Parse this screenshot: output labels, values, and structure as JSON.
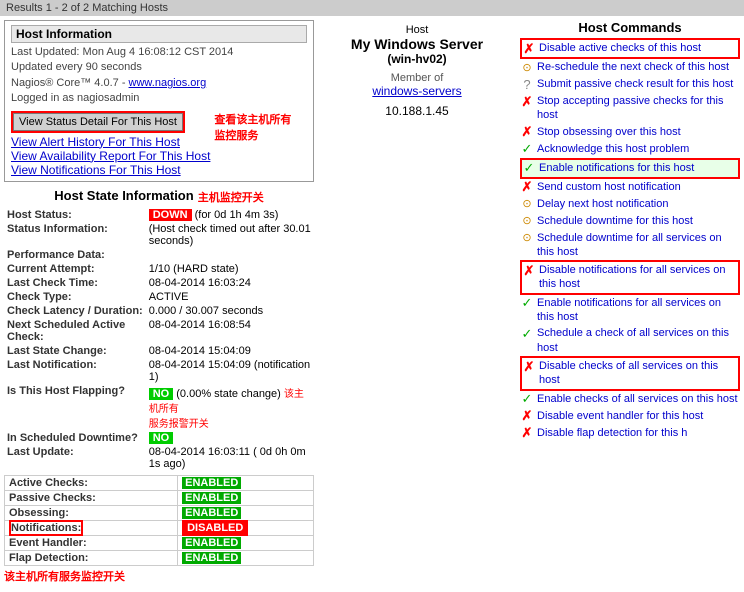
{
  "topbar": {
    "results_text": "Results 1 - 2 of 2 Matching Hosts"
  },
  "host_info": {
    "section_title": "Host Information",
    "last_updated": "Last Updated: Mon Aug 4 16:08:12 CST 2014",
    "update_interval": "Updated every 90 seconds",
    "nagios_version": "Nagios® Core™ 4.0.7 - ",
    "nagios_link_text": "www.nagios.org",
    "nagios_link": "http://www.nagios.org",
    "logged_in": "Logged in as nagiosadmin",
    "btn_view_status": "View Status Detail For This Host",
    "btn_view_alerts": "View Alert History For This Host",
    "btn_view_availability": "View Availability Report For This Host",
    "btn_view_notifications": "View Notifications For This Host",
    "annotation_1": "查看该主机所有\n监控服务"
  },
  "host_center": {
    "label": "Host",
    "name": "My Windows Server",
    "alias": "(win-hv02)",
    "member_of_label": "Member of",
    "member_group": "windows-servers",
    "ip_address": "10.188.1.45"
  },
  "host_state": {
    "section_title": "Host State Information",
    "annotation_title": "主机监控开关",
    "rows": [
      {
        "label": "Host Status:",
        "value": "",
        "badge": "DOWN",
        "badge_type": "down",
        "extra": "(for 0d 1h 4m 3s)"
      },
      {
        "label": "Status Information:",
        "value": "(Host check timed out after 30.01 seconds)",
        "badge": "",
        "badge_type": ""
      },
      {
        "label": "Performance Data:",
        "value": "",
        "badge": "",
        "badge_type": ""
      },
      {
        "label": "Current Attempt:",
        "value": "1/10  (HARD state)",
        "badge": "",
        "badge_type": ""
      },
      {
        "label": "Last Check Time:",
        "value": "08-04-2014 16:03:24",
        "badge": "",
        "badge_type": ""
      },
      {
        "label": "Check Type:",
        "value": "ACTIVE",
        "badge": "",
        "badge_type": ""
      },
      {
        "label": "Check Latency / Duration:",
        "value": "0.000 / 30.007 seconds",
        "badge": "",
        "badge_type": ""
      },
      {
        "label": "Next Scheduled Active Check:",
        "value": "08-04-2014 16:08:54",
        "badge": "",
        "badge_type": ""
      },
      {
        "label": "Last State Change:",
        "value": "08-04-2014 15:04:09",
        "badge": "",
        "badge_type": ""
      },
      {
        "label": "Last Notification:",
        "value": "08-04-2014 15:04:09 (notification 1)",
        "badge": "",
        "badge_type": ""
      },
      {
        "label": "Is This Host Flapping?",
        "value": "(0.00% state change)",
        "badge": "NO",
        "badge_type": "no"
      },
      {
        "label": "In Scheduled Downtime?",
        "value": "",
        "badge": "NO",
        "badge_type": "no"
      },
      {
        "label": "Last Update:",
        "value": "08-04-2014 16:03:11  ( 0d 0h 0m 1s ago)",
        "badge": "",
        "badge_type": ""
      }
    ],
    "annotation_flapping": "该主机所有\n服务报警开关"
  },
  "check_status": {
    "rows": [
      {
        "label": "Active Checks:",
        "badge": "ENABLED",
        "badge_type": "enabled"
      },
      {
        "label": "Passive Checks:",
        "badge": "ENABLED",
        "badge_type": "enabled"
      },
      {
        "label": "Obsessing:",
        "badge": "ENABLED",
        "badge_type": "enabled"
      },
      {
        "label": "Notifications:",
        "badge": "DISABLED",
        "badge_type": "disabled"
      },
      {
        "label": "Event Handler:",
        "badge": "ENABLED",
        "badge_type": "enabled"
      },
      {
        "label": "Flap Detection:",
        "badge": "ENABLED",
        "badge_type": "enabled"
      }
    ],
    "annotation": "该主机所有服务监控开关"
  },
  "commands": {
    "section_title": "Host Commands",
    "items": [
      {
        "icon": "x-red",
        "text": "Disable active checks of this host",
        "highlighted": true
      },
      {
        "icon": "clock-yellow",
        "text": "Re-schedule the next check of this host",
        "highlighted": false
      },
      {
        "icon": "question",
        "text": "Submit passive check result for this host",
        "highlighted": false
      },
      {
        "icon": "x-red",
        "text": "Stop accepting passive checks for this host",
        "highlighted": false
      },
      {
        "icon": "x-red",
        "text": "Stop obsessing over this host",
        "highlighted": false
      },
      {
        "icon": "check-green",
        "text": "Acknowledge this host problem",
        "highlighted": false
      },
      {
        "icon": "check-green",
        "text": "Enable notifications for this host",
        "highlighted": true,
        "highlight_color": "green"
      },
      {
        "icon": "x-red",
        "text": "Send custom host notification",
        "highlighted": false
      },
      {
        "icon": "clock-yellow",
        "text": "Delay next host notification",
        "highlighted": false
      },
      {
        "icon": "clock-yellow",
        "text": "Schedule downtime for this host",
        "highlighted": false
      },
      {
        "icon": "clock-yellow",
        "text": "Schedule downtime for all services on this host",
        "highlighted": false
      },
      {
        "icon": "x-red",
        "text": "Disable notifications for all services on this host",
        "highlighted": true
      },
      {
        "icon": "check-green",
        "text": "Enable notifications for all services on this host",
        "highlighted": false
      },
      {
        "icon": "check-green",
        "text": "Schedule a check of all services on this host",
        "highlighted": false
      },
      {
        "icon": "x-red",
        "text": "Disable checks of all services on this host",
        "highlighted": true
      },
      {
        "icon": "check-green",
        "text": "Enable checks of all services on this host",
        "highlighted": false
      },
      {
        "icon": "x-red",
        "text": "Disable event handler for this host",
        "highlighted": false
      },
      {
        "icon": "x-red",
        "text": "Disable flap detection for this h",
        "highlighted": false
      }
    ]
  }
}
